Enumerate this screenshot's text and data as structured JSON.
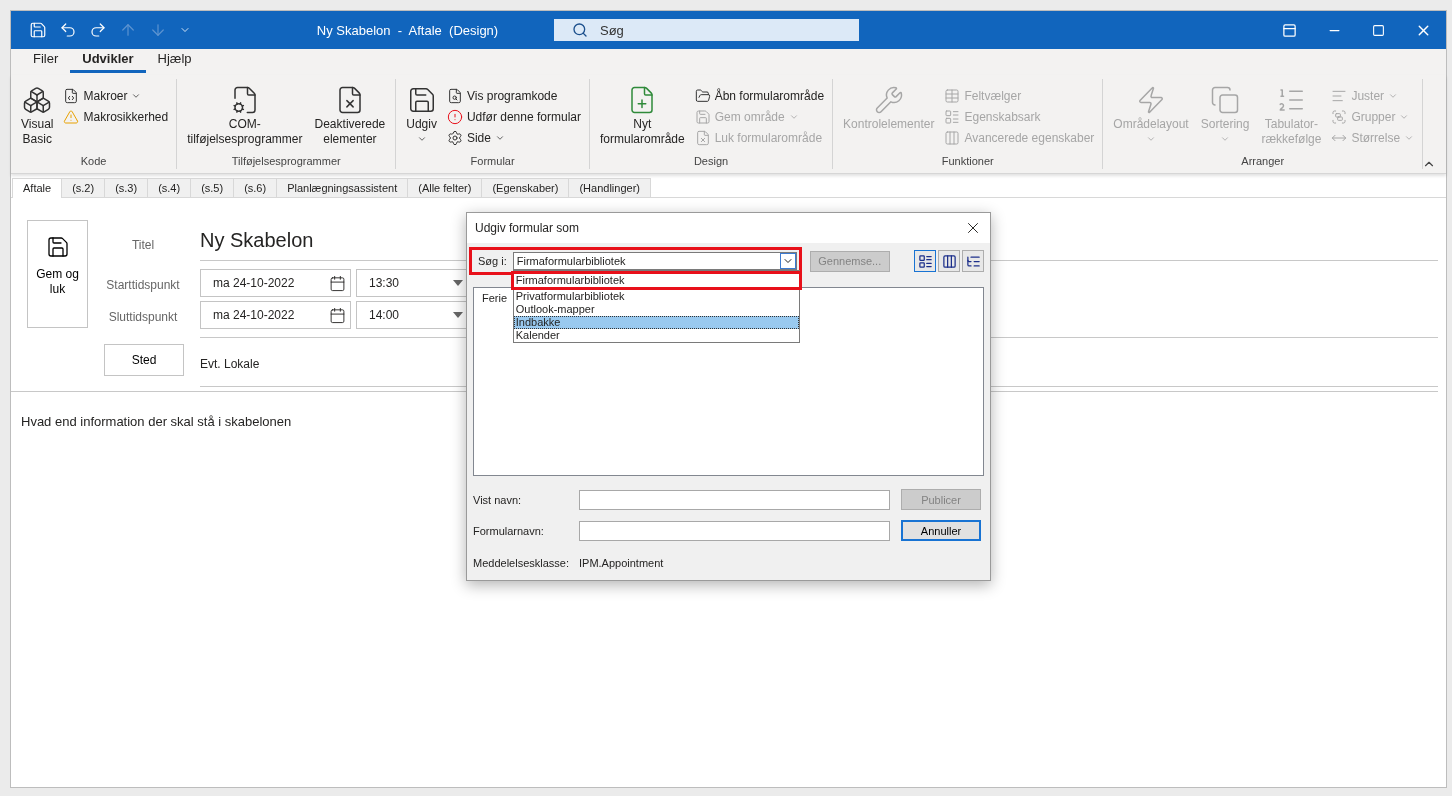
{
  "window": {
    "title": "Ny Skabelon  -  Aftale  (Design)",
    "search_placeholder": "Søg"
  },
  "quick_access": [
    {
      "disabled": false
    },
    {
      "disabled": false
    },
    {
      "disabled": false
    },
    {
      "disabled": true
    },
    {
      "disabled": true
    },
    {
      "disabled": false
    }
  ],
  "menu_tabs": [
    {
      "label": "Filer",
      "selected": false
    },
    {
      "label": "Udvikler",
      "selected": true
    },
    {
      "label": "Hjælp",
      "selected": false
    }
  ],
  "ribbon_groups": [
    {
      "label": "Kode",
      "items": [
        {
          "kind": "large",
          "label": "Visual Basic",
          "disabled": false,
          "dropdown": false
        },
        {
          "kind": "small",
          "label": "Makroer",
          "disabled": false,
          "dropdown": true
        },
        {
          "kind": "small",
          "label": "Makrosikkerhed",
          "disabled": false,
          "dropdown": false
        }
      ]
    },
    {
      "label": "Tilføjelsesprogrammer",
      "items": [
        {
          "kind": "large",
          "label": "COM-tilføjelsesprogrammer",
          "disabled": false,
          "dropdown": false
        },
        {
          "kind": "large",
          "label": "Deaktiverede elementer",
          "disabled": false,
          "dropdown": false
        }
      ]
    },
    {
      "label": "Formular",
      "items": [
        {
          "kind": "large",
          "label": "Udgiv",
          "disabled": false,
          "dropdown": true
        },
        {
          "kind": "small",
          "label": "Vis programkode",
          "disabled": false,
          "dropdown": false
        },
        {
          "kind": "small",
          "label": "Udfør denne formular",
          "disabled": false,
          "dropdown": false
        },
        {
          "kind": "small",
          "label": "Side",
          "disabled": false,
          "dropdown": true
        }
      ]
    },
    {
      "label": "Design",
      "items": [
        {
          "kind": "large",
          "label": "Nyt formularområde",
          "disabled": false,
          "dropdown": false
        },
        {
          "kind": "small",
          "label": "Åbn formularområde",
          "disabled": false,
          "dropdown": false
        },
        {
          "kind": "small",
          "label": "Gem område",
          "disabled": true,
          "dropdown": true
        },
        {
          "kind": "small",
          "label": "Luk formularområde",
          "disabled": true,
          "dropdown": false
        }
      ]
    },
    {
      "label": "Funktioner",
      "items": [
        {
          "kind": "large",
          "label": "Kontrolelementer",
          "disabled": true,
          "dropdown": false
        },
        {
          "kind": "small",
          "label": "Feltvælger",
          "disabled": true,
          "dropdown": false
        },
        {
          "kind": "small",
          "label": "Egenskabsark",
          "disabled": true,
          "dropdown": false
        },
        {
          "kind": "small",
          "label": "Avancerede egenskaber",
          "disabled": true,
          "dropdown": false
        }
      ]
    },
    {
      "label": "Arranger",
      "items": [
        {
          "kind": "large",
          "label": "Områdelayout",
          "disabled": true,
          "dropdown": true
        },
        {
          "kind": "large",
          "label": "Sortering",
          "disabled": true,
          "dropdown": true
        },
        {
          "kind": "large",
          "label": "Tabulator-rækkefølge",
          "disabled": true,
          "dropdown": false
        },
        {
          "kind": "small",
          "label": "Juster",
          "disabled": true,
          "dropdown": true
        },
        {
          "kind": "small",
          "label": "Grupper",
          "disabled": true,
          "dropdown": true
        },
        {
          "kind": "small",
          "label": "Størrelse",
          "disabled": true,
          "dropdown": true
        }
      ]
    }
  ],
  "form_tabs": [
    {
      "label": "Aftale",
      "selected": true
    },
    {
      "label": "(s.2)",
      "selected": false
    },
    {
      "label": "(s.3)",
      "selected": false
    },
    {
      "label": "(s.4)",
      "selected": false
    },
    {
      "label": "(s.5)",
      "selected": false
    },
    {
      "label": "(s.6)",
      "selected": false
    },
    {
      "label": "Planlægningsassistent",
      "selected": false
    },
    {
      "label": "(Alle felter)",
      "selected": false
    },
    {
      "label": "(Egenskaber)",
      "selected": false
    },
    {
      "label": "(Handlinger)",
      "selected": false
    }
  ],
  "form": {
    "save_button": "Gem og luk",
    "title_label": "Titel",
    "title_value": "Ny Skabelon",
    "time_rows": [
      {
        "label": "Starttidspunkt",
        "date": "ma 24-10-2022",
        "time": "13:30"
      },
      {
        "label": "Sluttidspunkt",
        "date": "ma 24-10-2022",
        "time": "14:00"
      }
    ],
    "location_button": "Sted",
    "location_value": "Evt. Lokale",
    "body": "Hvad end information der skal stå i skabelonen"
  },
  "dialog": {
    "title": "Udgiv formular som",
    "look_in": {
      "label": "Søg i:",
      "value": "Firmaformularbibliotek",
      "highlighted": true
    },
    "browse_button": {
      "label": "Gennemse...",
      "disabled": true
    },
    "view_buttons": [
      {
        "selected": true
      },
      {
        "selected": false
      },
      {
        "selected": false
      }
    ],
    "dropdown_options": [
      {
        "label": "Firmaformularbibliotek",
        "selected": false,
        "highlighted": true
      },
      {
        "label": "Privatformularbibliotek",
        "selected": false,
        "highlighted": false
      },
      {
        "label": "Outlook-mapper",
        "selected": false,
        "highlighted": false
      },
      {
        "label": "Indbakke",
        "selected": true,
        "highlighted": false
      },
      {
        "label": "Kalender",
        "selected": false,
        "highlighted": false
      }
    ],
    "list_items": [
      "Ferie"
    ],
    "display_name_label": "Vist navn:",
    "publish_button": {
      "label": "Publicer",
      "disabled": true
    },
    "form_name_label": "Formularnavn:",
    "cancel_button": {
      "label": "Annuller",
      "disabled": false
    },
    "class_label": "Meddelelsesklasse:",
    "class_value": "IPM.Appointment"
  }
}
